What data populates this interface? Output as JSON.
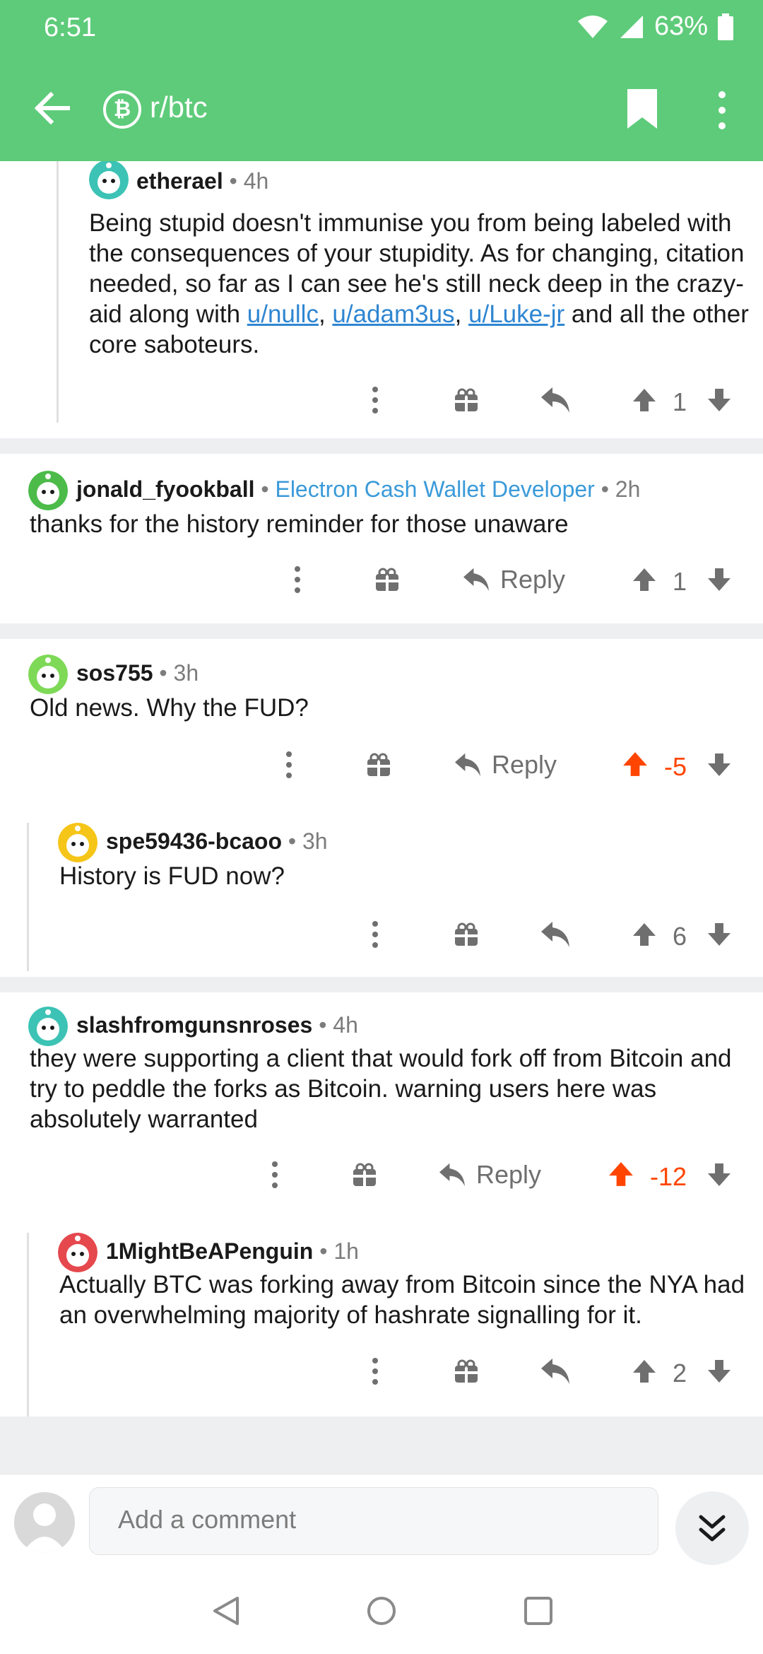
{
  "status_bar": {
    "time": "6:51",
    "battery": "63%"
  },
  "app_bar": {
    "subreddit": "r/btc",
    "sub_icon_glyph": "₿"
  },
  "comments": [
    {
      "user": "etherael",
      "time": "4h",
      "body_parts": [
        {
          "text": "Being stupid doesn't immunise you from being labeled with the consequences of your stupidity. As for changing, citation needed, so far as I can see he's still neck deep in the crazy-aid along with ",
          "link": false
        },
        {
          "text": "u/nullc",
          "link": true
        },
        {
          "text": ", ",
          "link": false
        },
        {
          "text": "u/adam3us",
          "link": true
        },
        {
          "text": ", ",
          "link": false
        },
        {
          "text": "u/Luke-jr",
          "link": true
        },
        {
          "text": " and all the other core saboteurs.",
          "link": false
        }
      ],
      "score": "1"
    },
    {
      "user": "jonald_fyookball",
      "flair": "Electron Cash Wallet Developer",
      "time": "2h",
      "body": "thanks for the history reminder for those unaware",
      "reply_label": "Reply",
      "score": "1"
    },
    {
      "user": "sos755",
      "time": "3h",
      "body": "Old news. Why the FUD?",
      "reply_label": "Reply",
      "score": "-5"
    },
    {
      "user": "spe59436-bcaoo",
      "time": "3h",
      "body": "History is FUD now?",
      "score": "6"
    },
    {
      "user": "slashfromgunsnroses",
      "time": "4h",
      "body": "they were supporting a client that would fork off from Bitcoin and try to peddle the forks as Bitcoin. warning users here was absolutely warranted",
      "reply_label": "Reply",
      "score": "-12"
    },
    {
      "user": "1MightBeAPenguin",
      "time": "1h",
      "body": "Actually BTC was forking away from Bitcoin since the NYA had an overwhelming majority of hashrate signalling for it.",
      "score": "2"
    }
  ],
  "composer": {
    "placeholder": "Add a comment"
  },
  "colors": {
    "brand": "#5ecb7a",
    "downvoted": "#ff4500",
    "link": "#2f86d1",
    "flair": "#3a9ad9"
  }
}
